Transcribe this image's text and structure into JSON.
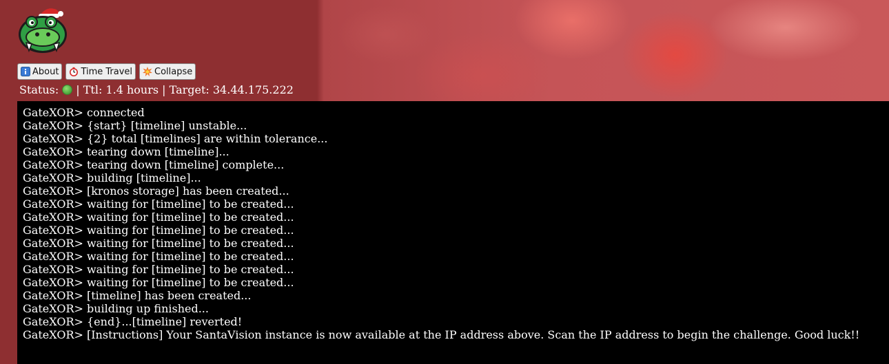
{
  "header": {
    "logo_icon": "crocodile-santa-hat-logo"
  },
  "toolbar": {
    "about_label": "About",
    "about_icon": "info-icon",
    "time_travel_label": "Time Travel",
    "time_travel_icon": "stopwatch-icon",
    "collapse_label": "Collapse",
    "collapse_icon": "explosion-icon"
  },
  "status": {
    "label": "Status:",
    "indicator_color": "#4aa53a",
    "ttl_text": "| Ttl: 1.4 hours | Target: 34.44.175.222"
  },
  "terminal": {
    "lines": [
      "GateXOR> connected",
      "GateXOR> {start} [timeline] unstable...",
      "GateXOR> {2} total [timelines] are within tolerance...",
      "GateXOR> tearing down [timeline]...",
      "GateXOR> tearing down [timeline] complete...",
      "GateXOR> building [timeline]...",
      "GateXOR> [kronos storage] has been created...",
      "GateXOR> waiting for [timeline] to be created...",
      "GateXOR> waiting for [timeline] to be created...",
      "GateXOR> waiting for [timeline] to be created...",
      "GateXOR> waiting for [timeline] to be created...",
      "GateXOR> waiting for [timeline] to be created...",
      "GateXOR> waiting for [timeline] to be created...",
      "GateXOR> waiting for [timeline] to be created...",
      "GateXOR> [timeline] has been created...",
      "GateXOR> building up finished...",
      "GateXOR> {end}...[timeline] reverted!",
      "GateXOR> [Instructions] Your SantaVision instance is now available at the IP address above. Scan the IP address to begin the challenge. Good luck!!"
    ]
  },
  "colors": {
    "page_background": "#8e2f31",
    "terminal_background": "#000000",
    "terminal_text": "#ffffff"
  }
}
